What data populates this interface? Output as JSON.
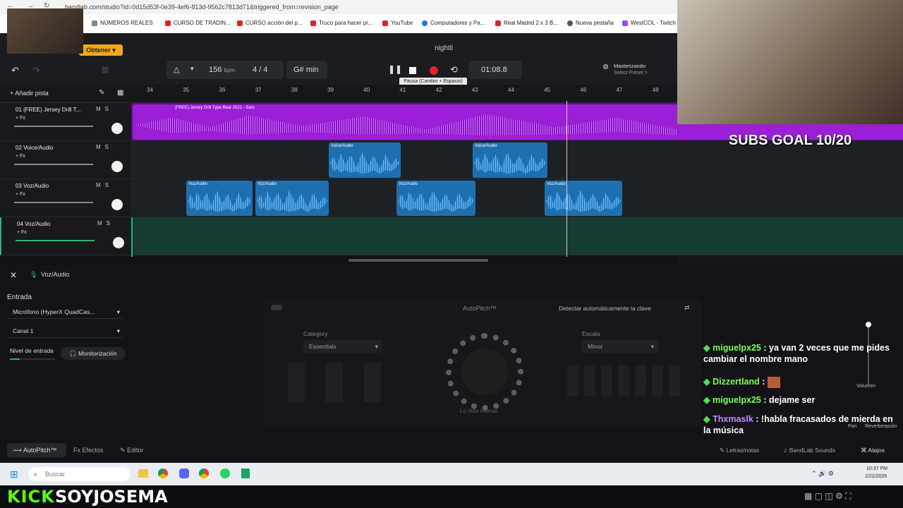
{
  "browser": {
    "url": "bandlab.com/studio?id=0d15d53f-0e39-4ef6-813d-9562c7813d71&triggered_from=revision_page",
    "bookmarks": [
      "NÚMEROS REALES",
      "CURSO DE TRADIN...",
      "CURSO acción del p...",
      "Truco para hacer pr...",
      "YouTube",
      "Computadores y Pa...",
      "Real Madrid 2 x 3 B...",
      "Nueva pestaña",
      "WestCOL - Twitch"
    ],
    "obtener_label": "Obtener"
  },
  "studio": {
    "project_name": "nightli",
    "tempo": "156",
    "tempo_unit": "bpm",
    "time_signature": "4 / 4",
    "key": "G# min",
    "time_display": "01:08.8",
    "pause_tooltip": "Pausa (Cambio + Espacio)",
    "mastering_title": "Masterizando",
    "mastering_sub": "Select Preset >",
    "add_track": "Añadir pista",
    "ruler_ticks": [
      "34",
      "35",
      "36",
      "37",
      "38",
      "39",
      "40",
      "41",
      "42",
      "43",
      "44",
      "45",
      "46",
      "47",
      "48"
    ],
    "colors": {
      "accent_purple": "#9b1fd6",
      "clip_blue": "#1f6fb0",
      "record_red": "#e02424"
    }
  },
  "tracks": [
    {
      "name": "01  (FREE) Jersey Drill T...",
      "fx": "+ Fx",
      "mute": "M",
      "solo": "S",
      "clip_label": "(FREE) Jersey Drill Type Beat 2022 - Sam"
    },
    {
      "name": "02  Voice/Audio",
      "fx": "+ Fx",
      "mute": "M",
      "solo": "S",
      "clips": [
        "Voice/Audio",
        "Voice/Audio"
      ]
    },
    {
      "name": "03  Voz/Audio",
      "fx": "+ Fx",
      "mute": "M",
      "solo": "S",
      "clips": [
        "Voz/Audio",
        "Voz/Audio",
        "Voz/Audio",
        "Voz/Audio"
      ]
    },
    {
      "name": "04  Voz/Audio",
      "fx": "+ Fx",
      "mute": "M",
      "solo": "S"
    }
  ],
  "panel": {
    "track_title": "Voz/Audio",
    "input_label": "Entrada",
    "mic_select": "Micrófono (HyperX QuadCas...",
    "channel_select": "Canal 1",
    "input_level": "Nivel de entrada",
    "monitoring": "Monitorización",
    "autopitch_title": "AutoPitch™",
    "detect_key": "Detectar automáticamente la clave",
    "category_label": "Category",
    "category_value": "Essentials",
    "scale_label": "Escala",
    "scale_value": "Minor",
    "knob_caption": "Lo más intenso",
    "volume_label": "Volumen",
    "pan_label": "Pan",
    "reverb_label": "Reverberación",
    "tabs": [
      "AutoPitch™",
      "Efectos",
      "Editor"
    ],
    "right_tabs": [
      "Letras/notas",
      "BandLab Sounds",
      "Atajos"
    ]
  },
  "stream": {
    "subs_goal": "SUBS GOAL 10/20",
    "chat": [
      {
        "user": "miguelpx25",
        "msg": ": ya van 2 veces que me pides cambiar el nombre mano"
      },
      {
        "user": "Dizzertland",
        "msg": ":"
      },
      {
        "user": "miguelpx25",
        "msg": ": dejame ser"
      },
      {
        "user": "Thxmaslk",
        "msg": ": !habla fracasados de mierda en la música"
      }
    ],
    "kick_brand": "KICK",
    "kick_channel": "SOYJOSEMA"
  },
  "taskbar": {
    "search_placeholder": "Buscar",
    "time": "10:37 PM",
    "date": "2/22/2026"
  }
}
